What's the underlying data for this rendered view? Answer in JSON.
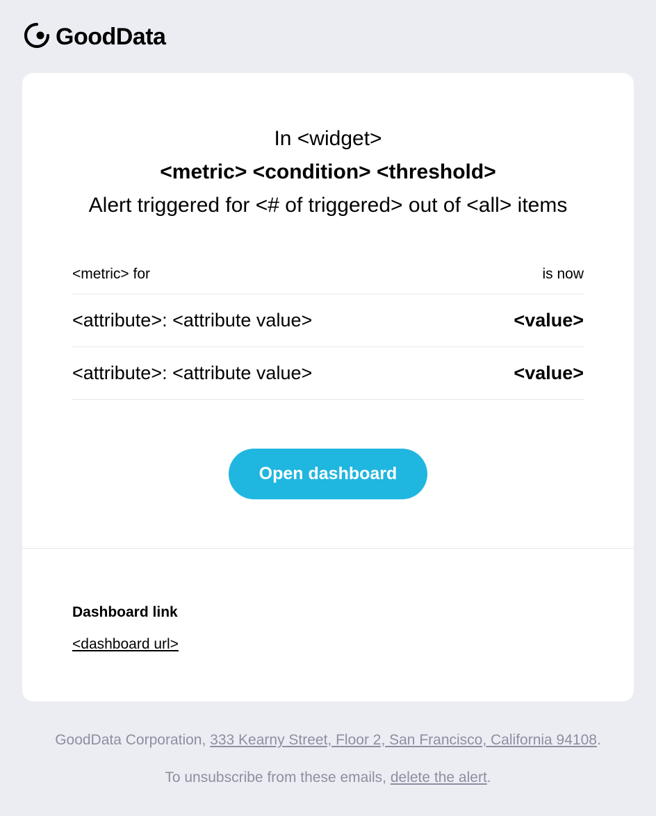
{
  "brand": "GoodData",
  "header": {
    "context_line": "In <widget>",
    "condition_line": "<metric> <condition> <threshold>",
    "summary_line": "Alert triggered for <# of triggered> out of <all> items"
  },
  "table": {
    "head_left": "<metric> for",
    "head_right": "is now",
    "rows": [
      {
        "label": "<attribute>: <attribute value>",
        "value": "<value>"
      },
      {
        "label": "<attribute>: <attribute value>",
        "value": "<value>"
      }
    ]
  },
  "cta_label": "Open dashboard",
  "link_section": {
    "heading": "Dashboard link",
    "url_text": "<dashboard url>"
  },
  "footer": {
    "company": "GoodData Corporation, ",
    "address": "333 Kearny Street, Floor 2, San Francisco, California 94108",
    "address_trail": ".",
    "unsub_prefix": "To unsubscribe from these emails, ",
    "unsub_action": "delete the alert",
    "unsub_trail": "."
  }
}
